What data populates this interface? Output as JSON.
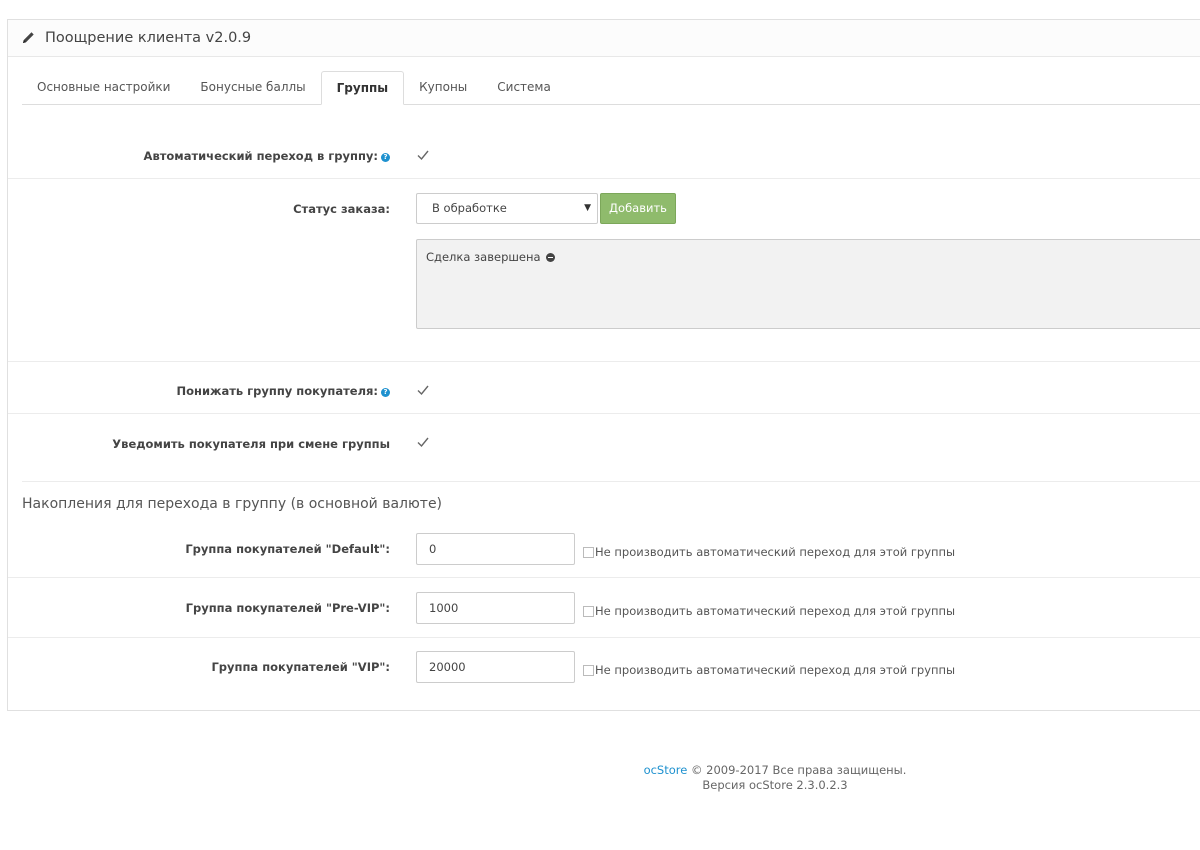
{
  "panel": {
    "title": "Поощрение клиента v2.0.9"
  },
  "tabs": [
    {
      "label": "Основные настройки"
    },
    {
      "label": "Бонусные баллы"
    },
    {
      "label": "Группы"
    },
    {
      "label": "Купоны"
    },
    {
      "label": "Система"
    }
  ],
  "active_tab": "Группы",
  "auto_transition": {
    "label": "Автоматический переход в группу:",
    "checked": true
  },
  "order_status": {
    "label": "Статус заказа:",
    "selected": "В обработке",
    "add_label": "Добавить",
    "items": [
      "Сделка завершена"
    ]
  },
  "downgrade": {
    "label": "Понижать группу покупателя:",
    "checked": true
  },
  "notify": {
    "label": "Уведомить покупателя при смене группы",
    "checked": true
  },
  "accumulation": {
    "title": "Накопления для перехода в группу (в основной валюте)",
    "skip_label": "Не производить автоматический переход для этой группы",
    "groups": [
      {
        "label": "Группа покупателей \"Default\":",
        "value": "0"
      },
      {
        "label": "Группа покупателей \"Pre-VIP\":",
        "value": "1000"
      },
      {
        "label": "Группа покупателей \"VIP\":",
        "value": "20000"
      }
    ]
  },
  "footer": {
    "brand": "ocStore",
    "copyright": " © 2009-2017 Все права защищены.",
    "version": "Версия ocStore 2.3.0.2.3"
  }
}
